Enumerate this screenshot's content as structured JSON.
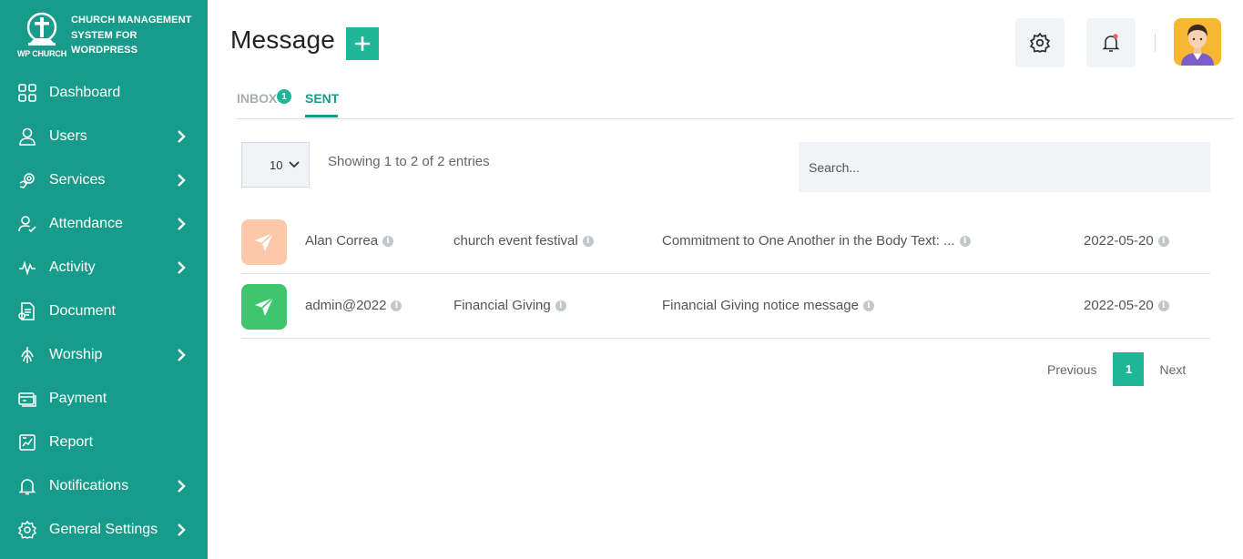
{
  "brand": {
    "logo_label": "WP CHURCH",
    "title": "CHURCH MANAGEMENT SYSTEM FOR WORDPRESS"
  },
  "sidebar": {
    "items": [
      {
        "label": "Dashboard",
        "icon": "grid-icon",
        "has_submenu": false
      },
      {
        "label": "Users",
        "icon": "user-icon",
        "has_submenu": true
      },
      {
        "label": "Services",
        "icon": "services-icon",
        "has_submenu": true
      },
      {
        "label": "Attendance",
        "icon": "attendance-icon",
        "has_submenu": true
      },
      {
        "label": "Activity",
        "icon": "activity-pulse-icon",
        "has_submenu": true
      },
      {
        "label": "Document",
        "icon": "document-icon",
        "has_submenu": false
      },
      {
        "label": "Worship",
        "icon": "worship-icon",
        "has_submenu": true
      },
      {
        "label": "Payment",
        "icon": "payment-icon",
        "has_submenu": false
      },
      {
        "label": "Report",
        "icon": "report-icon",
        "has_submenu": false
      },
      {
        "label": "Notifications",
        "icon": "bell-icon",
        "has_submenu": true
      },
      {
        "label": "General Settings",
        "icon": "gear-icon",
        "has_submenu": true
      }
    ]
  },
  "header": {
    "title": "Message",
    "add_symbol": "+"
  },
  "tabs": {
    "inbox": {
      "label": "INBOX",
      "badge": "1"
    },
    "sent": {
      "label": "SENT"
    }
  },
  "table_controls": {
    "page_length": "10",
    "info": "Showing 1 to 2 of 2 entries",
    "search_placeholder": "Search..."
  },
  "rows": [
    {
      "recipient": "Alan Correa",
      "subject": "church event festival",
      "message": "Commitment to One Another in the Body Text: ...",
      "date": "2022-05-20",
      "icon_color": "#fcc8a9"
    },
    {
      "recipient": "admin@2022",
      "subject": "Financial Giving",
      "message": "Financial Giving notice message",
      "date": "2022-05-20",
      "icon_color": "#3fc56e"
    }
  ],
  "pagination": {
    "previous": "Previous",
    "current": "1",
    "next": "Next"
  },
  "colors": {
    "sidebar": "#179c8c",
    "accent": "#1fb597"
  }
}
